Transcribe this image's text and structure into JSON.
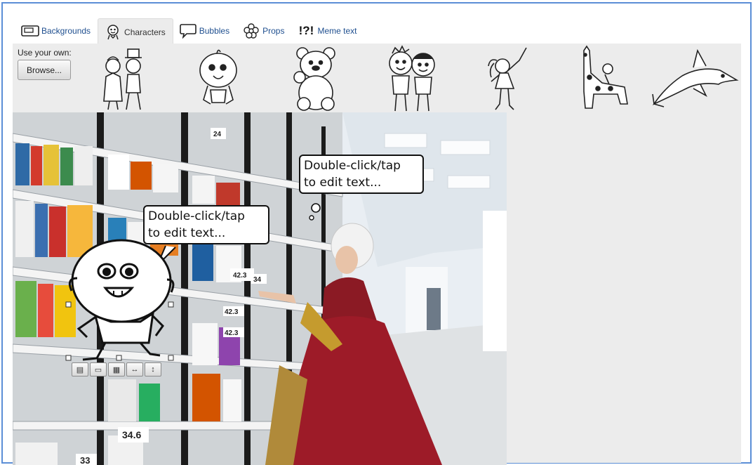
{
  "tabs": [
    {
      "label": "Backgrounds",
      "icon": "background-icon"
    },
    {
      "label": "Characters",
      "icon": "character-icon"
    },
    {
      "label": "Bubbles",
      "icon": "bubble-icon"
    },
    {
      "label": "Props",
      "icon": "flower-icon"
    },
    {
      "label": "Meme text",
      "icon": "meme-text-icon",
      "glyph": "!?!"
    }
  ],
  "active_tab": "Characters",
  "panel": {
    "use_own_label": "Use your own:",
    "browse_label": "Browse..."
  },
  "characters": [
    "couple-icon",
    "baby-icon",
    "teddy-bear-icon",
    "two-boys-icon",
    "dancing-girl-icon",
    "giraffe-icon",
    "dolphin-icon"
  ],
  "canvas": {
    "bubbles": [
      {
        "text": "Double-click/tap\nto edit text..."
      },
      {
        "text": "Double-click/tap\nto edit text..."
      }
    ],
    "shelf_labels": [
      "24",
      "42.3",
      "34",
      "42.3",
      "42.3",
      "34.6",
      "33"
    ],
    "selection_toolbar": [
      "layer-back-icon",
      "speech-icon",
      "picture-icon",
      "flip-horizontal-icon",
      "flip-vertical-icon"
    ]
  },
  "colors": {
    "accent": "#5b8ed6",
    "link": "#1f4f8f",
    "panel": "#ececec"
  }
}
